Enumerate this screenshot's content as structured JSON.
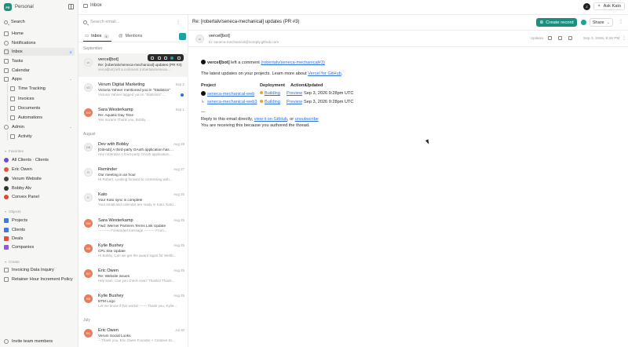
{
  "sidebar": {
    "workspace_initials": "PE",
    "workspace": "Personal",
    "search": "Search",
    "nav": [
      {
        "label": "Home"
      },
      {
        "label": "Notifications"
      },
      {
        "label": "Inbox",
        "badge": "4"
      },
      {
        "label": "Tasks"
      },
      {
        "label": "Calendar"
      },
      {
        "label": "Apps"
      },
      {
        "label": "Time Tracking"
      },
      {
        "label": "Invoices"
      },
      {
        "label": "Documents"
      },
      {
        "label": "Automations"
      },
      {
        "label": "Admin"
      },
      {
        "label": "Activity"
      }
    ],
    "favorites_title": "Favorites",
    "favorites": [
      {
        "label": "All Clients · Clients",
        "color": "#6b4bd8"
      },
      {
        "label": "Eric Owen",
        "color": "#e0533b"
      },
      {
        "label": "Verum Website",
        "color": "#444444"
      },
      {
        "label": "Bobby Alv",
        "color": "#333333"
      },
      {
        "label": "Convex Panel",
        "color": "#d94a3a"
      }
    ],
    "objects_title": "Objects",
    "objects": [
      {
        "label": "Projects",
        "color": "#3d7be0"
      },
      {
        "label": "Clients",
        "color": "#3d7be0"
      },
      {
        "label": "Deals",
        "color": "#e0533b"
      },
      {
        "label": "Companies",
        "color": "#8a5be0"
      }
    ],
    "create_title": "Create",
    "create": [
      {
        "label": "Invoicing Data Inquiry"
      },
      {
        "label": "Retainer Hour Increment Policy"
      }
    ],
    "invite": "Invite team members"
  },
  "topbar": {
    "title": "Inbox",
    "user_initial": "Z",
    "ask": "Ask Kato"
  },
  "list": {
    "search_placeholder": "Search email...",
    "tab_inbox": "Inbox",
    "tab_inbox_count": "4",
    "tab_mentions": "Mentions",
    "group_september": "September",
    "group_august": "August",
    "group_july": "July",
    "items": [
      {
        "av": "vc",
        "from": "vercel[bot]",
        "date": "",
        "subject": "Re: [robertalv/seneca-mechanical] updates (PR #3)",
        "preview": "vercel[bot] left a comment (robertalv/seneca-..."
      },
      {
        "av": "VD",
        "from": "Verum Digital Marketing",
        "date": "Sep 2",
        "subject": "Victoria Yahner mentioned you in \"Statistics\"",
        "preview": "Victoria Yahner tagged you in \"Statistics\" ..."
      },
      {
        "av": "SW",
        "from": "Sara Westerkamp",
        "date": "Sep 1",
        "subject": "Re: Aquatic Day Time",
        "preview": "Yes ma'am! Thank you, Bobby ..."
      },
      {
        "av": "DB",
        "from": "Dev with Bobby",
        "date": "Aug 29",
        "subject": "[GitHub] A third-party OAuth application has ...",
        "preview": "Hey robertalv! A third-party OAuth application..."
      },
      {
        "av": "R",
        "from": "Reminder",
        "date": "Aug 27",
        "subject": "Our meeting in an hour",
        "preview": "Hi Robert, Looking forward to connecting with..."
      },
      {
        "av": "K",
        "from": "Kato",
        "date": "Aug 25",
        "subject": "Your Kato sync is complete",
        "preview": "Your email and calendar are ready in Kato. Kato..."
      },
      {
        "av": "SW",
        "from": "Sara Westerkamp",
        "date": "Aug 25",
        "subject": "Fwd: Werner Partners Terms Link Update",
        "preview": "---------- Forwarded message --------- From..."
      },
      {
        "av": "KB",
        "from": "Kylie Bushey",
        "date": "Aug 25",
        "subject": "CPL Site Update",
        "preview": "Hi Bobby, Can we get the award logos for Webb..."
      },
      {
        "av": "EO",
        "from": "Eric Owen",
        "date": "Aug 25",
        "subject": "Re: Website issues",
        "preview": "Hey Sam, Can you check now? Thanks! Thank..."
      },
      {
        "av": "KB",
        "from": "Kylie Bushey",
        "date": "Aug 25",
        "subject": "BTM Logo",
        "preview": "Let me know if this works! ------ Thank you, Kylie..."
      },
      {
        "av": "EO",
        "from": "Eric Owen",
        "date": "Jul 30",
        "subject": "Verum Social Looks",
        "preview": "-- Thank you, Eric Owen Founder + Creative Di..."
      }
    ]
  },
  "reader": {
    "title": "Re: [robertalv/seneca-mechanical] updates (PR #3)",
    "create_record": "Create record",
    "share": "Share",
    "from_av": "vc",
    "from": "vercel[bot]",
    "to": "to: seneca-mechanical@noreply.github.com",
    "updates_label": "Updates",
    "date": "Sep 3, 2026, 9:28 PM",
    "body": {
      "bot": "vercel[bot]",
      "left_comment": "left a comment",
      "pr_link": "(robertalv/seneca-mechanical#3)",
      "intro": "The latest updates on your projects. Learn more about",
      "vercel_link": "Vercel for GitHub",
      "col_project": "Project",
      "col_deploy": "Deployment",
      "col_actions": "Actions",
      "col_updated": "Updated",
      "rows": [
        {
          "project": "seneca-mechanical-web",
          "status": "Building",
          "action": "Preview",
          "updated": "Sep 3, 2026 9:28pm UTC"
        },
        {
          "project": "seneca-mechanical-web3",
          "status": "Building",
          "action": "Preview",
          "updated": "Sep 3, 2026 9:28pm UTC"
        }
      ],
      "sep": "—",
      "reply_text": "Reply to this email directly,",
      "view_link": "view it on GitHub",
      "or_text": ", or",
      "unsub_link": "unsubscribe",
      "reason": "You are receiving this because you authored the thread."
    }
  },
  "colors": {
    "accent": "#1b8f7e",
    "link": "#2f6fdb",
    "building": "#f0a030",
    "avatar_orange": "#f07b5c"
  }
}
